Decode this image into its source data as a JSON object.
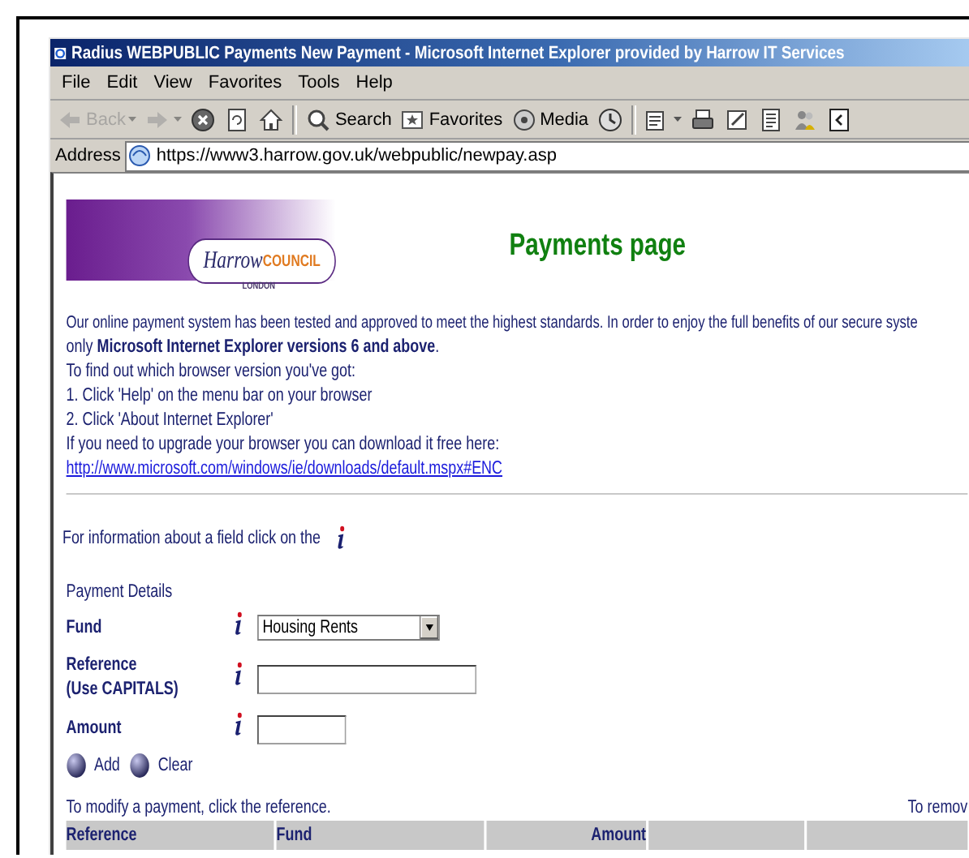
{
  "window": {
    "title": "Radius WEBPUBLIC Payments New Payment - Microsoft Internet Explorer provided by Harrow IT Services"
  },
  "menu": [
    {
      "label": "File"
    },
    {
      "label": "Edit"
    },
    {
      "label": "View"
    },
    {
      "label": "Favorites"
    },
    {
      "label": "Tools"
    },
    {
      "label": "Help"
    }
  ],
  "toolbar": [
    {
      "kind": "back",
      "label": "Back",
      "disabled": true
    },
    {
      "kind": "forward",
      "disabled": true
    },
    {
      "kind": "stop",
      "disabled": false
    },
    {
      "kind": "refresh",
      "disabled": false
    },
    {
      "kind": "home",
      "disabled": false
    },
    {
      "kind": "search",
      "label": "Search",
      "disabled": false
    },
    {
      "kind": "favorites",
      "label": "Favorites",
      "disabled": false
    },
    {
      "kind": "media",
      "label": "Media",
      "disabled": false
    },
    {
      "kind": "history",
      "disabled": false
    },
    {
      "kind": "mail",
      "disabled": false
    },
    {
      "kind": "print",
      "disabled": false
    },
    {
      "kind": "edit",
      "disabled": false
    },
    {
      "kind": "discuss",
      "disabled": false
    },
    {
      "kind": "messenger",
      "disabled": false
    },
    {
      "kind": "research",
      "disabled": false
    }
  ],
  "address": {
    "label": "Address",
    "value": "https://www3.harrow.gov.uk/webpublic/newpay.asp"
  },
  "page": {
    "logo": {
      "name": "Harrow",
      "suffix": "COUNCIL",
      "subtitle": "LONDON"
    },
    "heading": "Payments page",
    "intro": [
      "Our online payment system has been tested and approved to meet the highest standards. In order to enjoy the full benefits of our secure syste",
      "only **Microsoft Internet Explorer versions 6 and above**.",
      "To find out which browser version you've got:",
      "1. Click 'Help' on the menu bar on your browser",
      "2. Click 'About Internet Explorer'",
      "If you need to upgrade your browser you can download it free here:"
    ],
    "link": "http://www.microsoft.com/windows/ie/downloads/default.mspx#ENC",
    "info_hint": "For information about a field click on the",
    "section": "Payment Details",
    "fields": [
      {
        "kind": "select",
        "label": "Fund",
        "value": "Housing Rents"
      },
      {
        "kind": "text",
        "label": "Reference",
        "sublabel": "(Use CAPITALS)"
      },
      {
        "kind": "amount",
        "label": "Amount"
      }
    ],
    "actions": [
      {
        "label": "Add"
      },
      {
        "label": "Clear"
      }
    ],
    "table_hint": "To modify a payment, click the reference.",
    "table_hint_right": "To remov",
    "table": {
      "columns": [
        {
          "kind": "text",
          "label": "Reference"
        },
        {
          "kind": "text",
          "label": "Fund"
        },
        {
          "kind": "number",
          "label": "Amount"
        },
        {
          "kind": "blank"
        },
        {
          "kind": "blank"
        }
      ]
    }
  }
}
